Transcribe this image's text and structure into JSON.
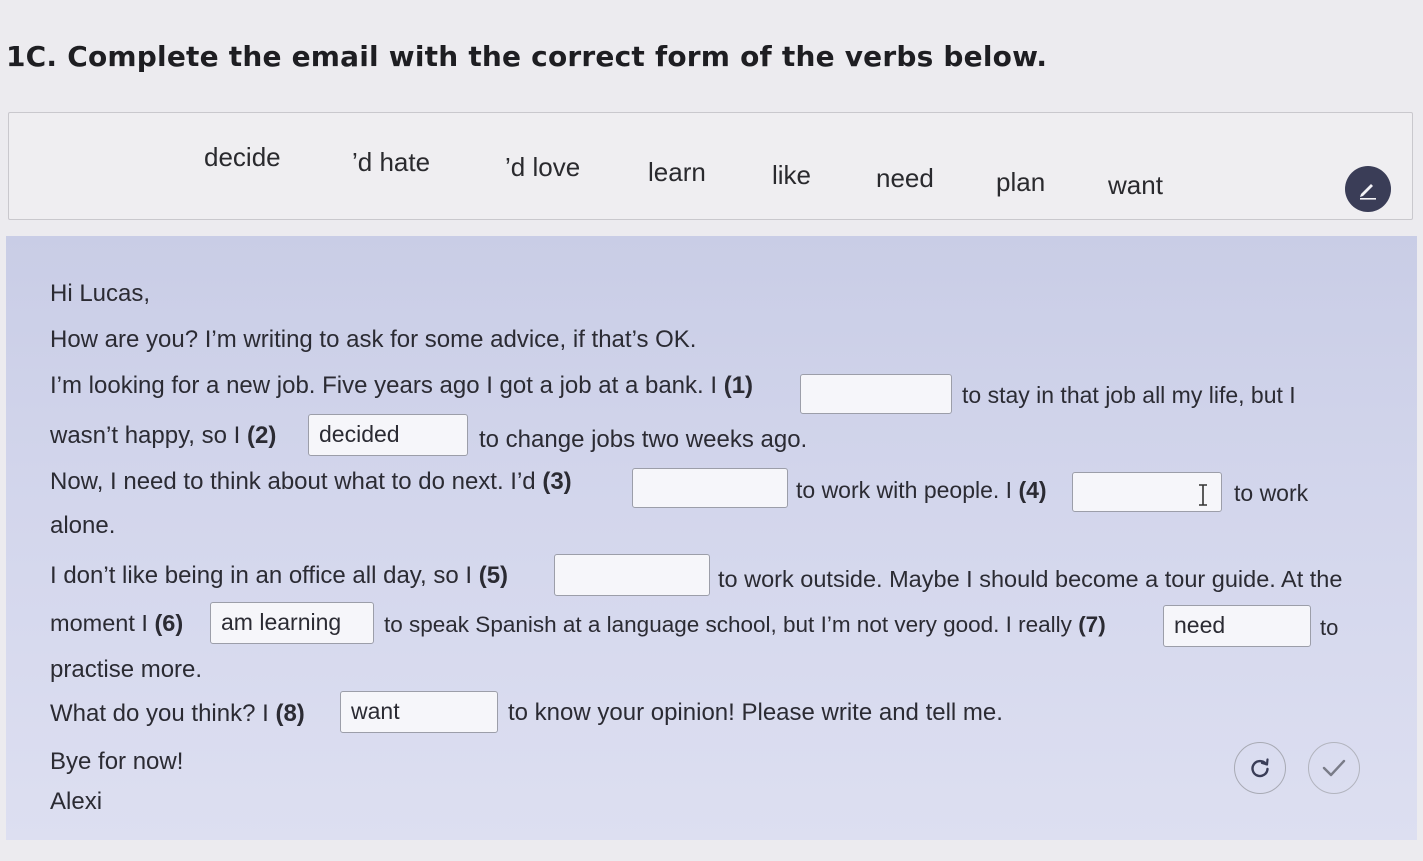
{
  "exercise": {
    "title": "1C. Complete the email with the correct form of the verbs below."
  },
  "word_bank": [
    "decide",
    "’d hate",
    "’d love",
    "learn",
    "like",
    "need",
    "plan",
    "want"
  ],
  "email": {
    "greeting": "Hi Lucas,",
    "line1": "How are you? I’m writing to ask for some advice, if that’s OK.",
    "line2_pre": "I’m looking for a new job. Five years ago I got a job at a bank. I",
    "line2_post": "to stay in that job all my life, but I",
    "line3_pre": "wasn’t happy, so I",
    "line3_post": "to change jobs two weeks ago.",
    "line4_pre": "Now, I need to think about what to do next. I’d",
    "line4_mid": "to work with people. I",
    "line4_post": "to work",
    "line5": "alone.",
    "line6_pre": "I don’t like being in an office all day, so I",
    "line6_post": "to work outside. Maybe I should become a tour guide. At the",
    "line7_pre": "moment I",
    "line7_mid": "to speak Spanish at a language school, but I’m not very good. I really",
    "line7_post": "to",
    "line8": "practise more.",
    "line9_pre": "What do you think? I",
    "line9_post": "to know your opinion! Please write and tell me.",
    "signoff": "Bye for now!",
    "signature": "Alexi"
  },
  "gaps": [
    {
      "number": "(1)",
      "value": ""
    },
    {
      "number": "(2)",
      "value": "decided"
    },
    {
      "number": "(3)",
      "value": ""
    },
    {
      "number": "(4)",
      "value": ""
    },
    {
      "number": "(5)",
      "value": ""
    },
    {
      "number": "(6)",
      "value": "am learning"
    },
    {
      "number": "(7)",
      "value": "need"
    },
    {
      "number": "(8)",
      "value": "want"
    }
  ],
  "icons": {
    "edit": "pencil-icon",
    "reset": "reset-icon",
    "check": "check-icon"
  },
  "colors": {
    "panel": "#cdd1e8",
    "pen_button": "#3a3d57"
  }
}
